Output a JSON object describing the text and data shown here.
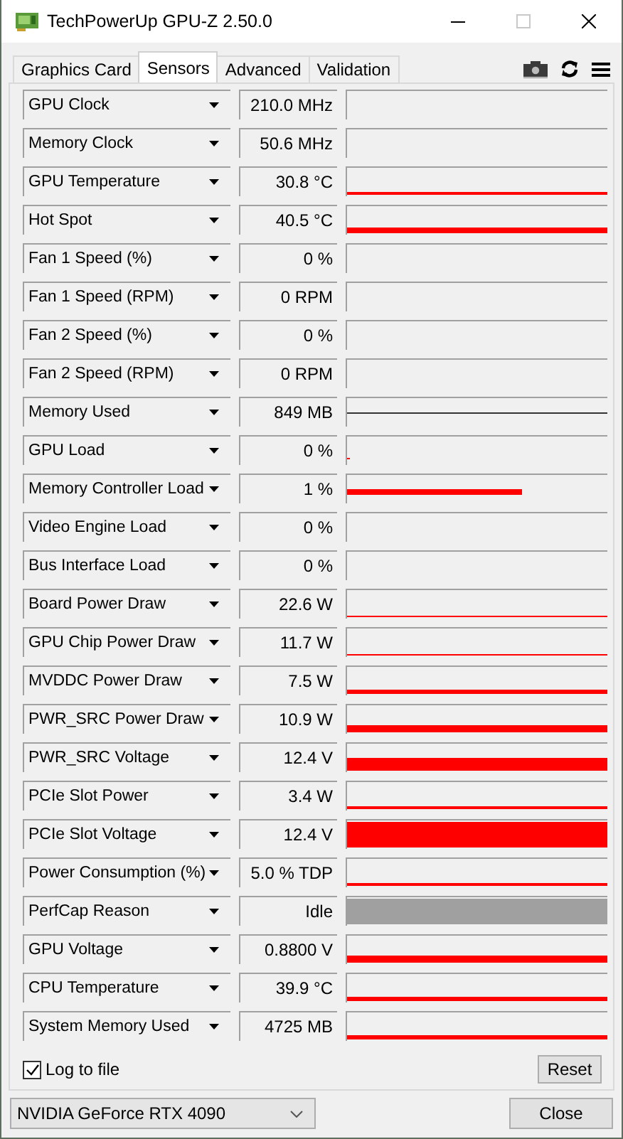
{
  "window": {
    "title": "TechPowerUp GPU-Z 2.50.0",
    "maximize_enabled": false
  },
  "tabs": [
    {
      "label": "Graphics Card",
      "selected": false
    },
    {
      "label": "Sensors",
      "selected": true
    },
    {
      "label": "Advanced",
      "selected": false
    },
    {
      "label": "Validation",
      "selected": false
    }
  ],
  "sensors": [
    {
      "name": "GPU Clock",
      "value": "210.0 MHz"
    },
    {
      "name": "Memory Clock",
      "value": "50.6 MHz"
    },
    {
      "name": "GPU Temperature",
      "value": "30.8 °C"
    },
    {
      "name": "Hot Spot",
      "value": "40.5 °C"
    },
    {
      "name": "Fan 1 Speed (%)",
      "value": "0 %"
    },
    {
      "name": "Fan 1 Speed (RPM)",
      "value": "0 RPM"
    },
    {
      "name": "Fan 2 Speed (%)",
      "value": "0 %"
    },
    {
      "name": "Fan 2 Speed (RPM)",
      "value": "0 RPM"
    },
    {
      "name": "Memory Used",
      "value": "849 MB"
    },
    {
      "name": "GPU Load",
      "value": "0 %"
    },
    {
      "name": "Memory Controller Load",
      "value": "1 %"
    },
    {
      "name": "Video Engine Load",
      "value": "0 %"
    },
    {
      "name": "Bus Interface Load",
      "value": "0 %"
    },
    {
      "name": "Board Power Draw",
      "value": "22.6 W"
    },
    {
      "name": "GPU Chip Power Draw",
      "value": "11.7 W"
    },
    {
      "name": "MVDDC Power Draw",
      "value": "7.5 W"
    },
    {
      "name": "PWR_SRC Power Draw",
      "value": "10.9 W"
    },
    {
      "name": "PWR_SRC Voltage",
      "value": "12.4 V"
    },
    {
      "name": "PCIe Slot Power",
      "value": "3.4 W"
    },
    {
      "name": "PCIe Slot Voltage",
      "value": "12.4 V"
    },
    {
      "name": "Power Consumption (%)",
      "value": "5.0 % TDP"
    },
    {
      "name": "PerfCap Reason",
      "value": "Idle"
    },
    {
      "name": "GPU Voltage",
      "value": "0.8800 V"
    },
    {
      "name": "CPU Temperature",
      "value": "39.9 °C"
    },
    {
      "name": "System Memory Used",
      "value": "4725 MB"
    }
  ],
  "log_to_file": {
    "label": "Log to file",
    "checked": true
  },
  "reset_button": "Reset",
  "gpu_select": {
    "value": "NVIDIA GeForce RTX 4090"
  },
  "close_button": "Close"
}
